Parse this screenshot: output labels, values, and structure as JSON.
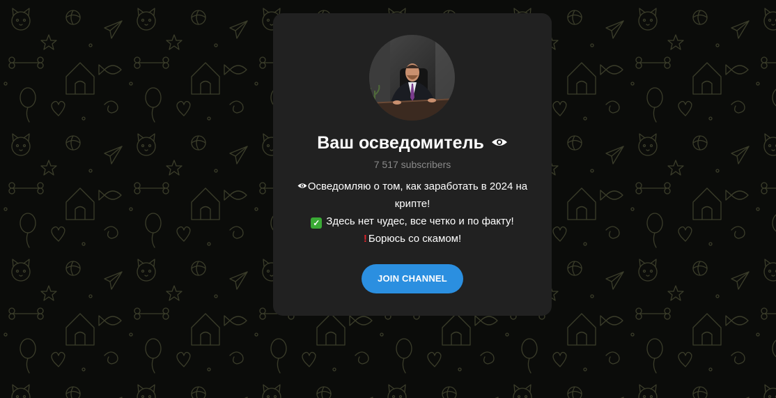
{
  "channel": {
    "title": "Ваш осведомитель",
    "title_icon": "eye-icon",
    "subscribers": "7 517 subscribers",
    "description": {
      "line1": "Осведомляю о том, как заработать в 2024 на",
      "line1_icon": "eye-icon",
      "line2": "крипте!",
      "line3": "Здесь нет чудес, все четко и по факту!",
      "line3_icon": "check-mark-icon",
      "line4": "Борюсь со скамом!",
      "line4_icon": "exclamation-icon"
    }
  },
  "join_button": {
    "label": "JOIN CHANNEL"
  },
  "colors": {
    "background": "#0b0c0a",
    "pattern": "#3b3d2a",
    "card": "#212121",
    "accent": "#2b8fe0",
    "subtext": "#8a8a8a"
  }
}
